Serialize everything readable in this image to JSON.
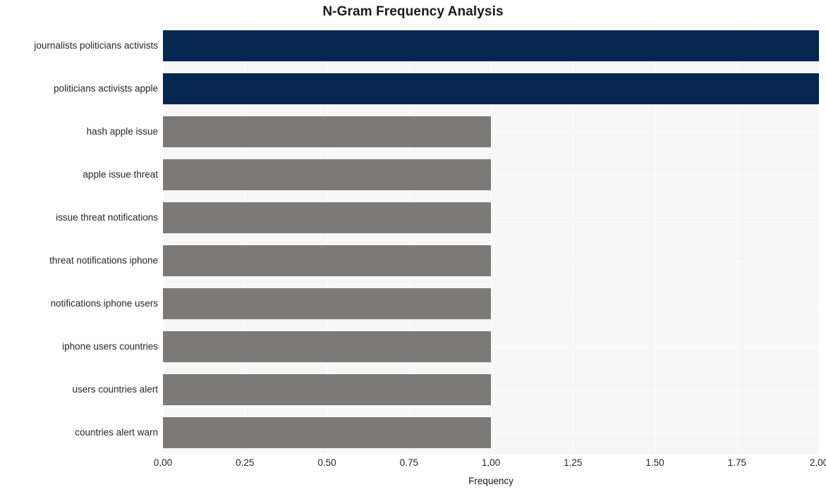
{
  "chart_data": {
    "type": "bar",
    "orientation": "horizontal",
    "title": "N-Gram Frequency Analysis",
    "xlabel": "Frequency",
    "ylabel": "",
    "xlim": [
      0,
      2
    ],
    "xticks": [
      "0.00",
      "0.25",
      "0.50",
      "0.75",
      "1.00",
      "1.25",
      "1.50",
      "1.75",
      "2.00"
    ],
    "xtick_values": [
      0,
      0.25,
      0.5,
      0.75,
      1.0,
      1.25,
      1.5,
      1.75,
      2.0
    ],
    "grid": true,
    "legend": "none",
    "categories": [
      "journalists politicians activists",
      "politicians activists apple",
      "hash apple issue",
      "apple issue threat",
      "issue threat notifications",
      "threat notifications iphone",
      "notifications iphone users",
      "iphone users countries",
      "users countries alert",
      "countries alert warn"
    ],
    "values": [
      2,
      2,
      1,
      1,
      1,
      1,
      1,
      1,
      1,
      1
    ],
    "bar_colors": [
      "#04264f",
      "#04264f",
      "#7b7a78",
      "#7b7a78",
      "#7b7a78",
      "#7b7a78",
      "#7b7a78",
      "#7b7a78",
      "#7b7a78",
      "#7b7a78"
    ]
  },
  "colors": {
    "highlight": "#04264f",
    "normal": "#7b7a78",
    "plot_background": "#f7f7f7",
    "gridline": "#ffffff",
    "figure_background": "#ffffff",
    "text": "#262626"
  }
}
